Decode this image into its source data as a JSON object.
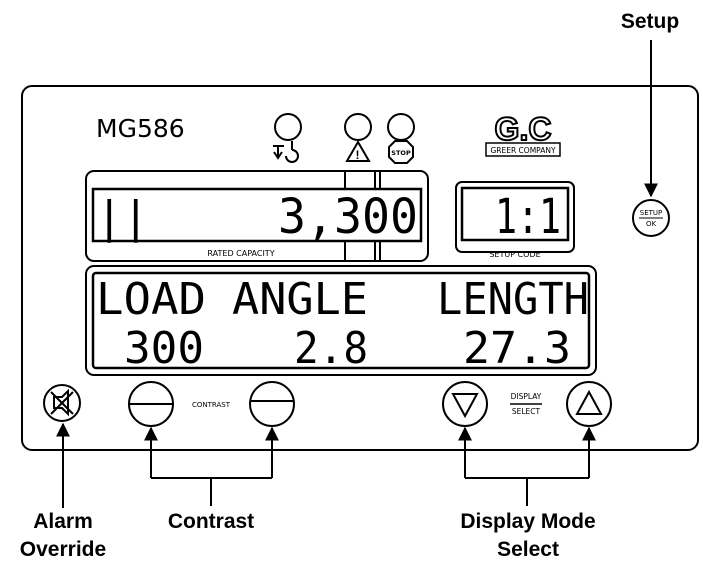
{
  "panel": {
    "model": "MG586",
    "logo_letters": "G.C",
    "logo_company": "GREER COMPANY"
  },
  "rated_display": {
    "bar_glyph": "||",
    "value": "3,300",
    "label": "RATED CAPACITY"
  },
  "setup_display": {
    "value": "1:1",
    "label": "SETUP CODE"
  },
  "main_display": {
    "headers": [
      "LOAD",
      "ANGLE",
      "LENGTH"
    ],
    "values": [
      "300",
      "2.8",
      "27.3"
    ]
  },
  "buttons": {
    "setup_top": "SETUP",
    "setup_bottom": "OK",
    "contrast_label": "CONTRAST",
    "display_select_top": "DISPLAY",
    "display_select_bottom": "SELECT"
  },
  "indicators": {
    "stop_label": "STOP",
    "warning_glyph": "!"
  },
  "callouts": {
    "setup": "Setup",
    "alarm_line1": "Alarm",
    "alarm_line2": "Override",
    "contrast": "Contrast",
    "display_mode_line1": "Display Mode",
    "display_mode_line2": "Select"
  }
}
